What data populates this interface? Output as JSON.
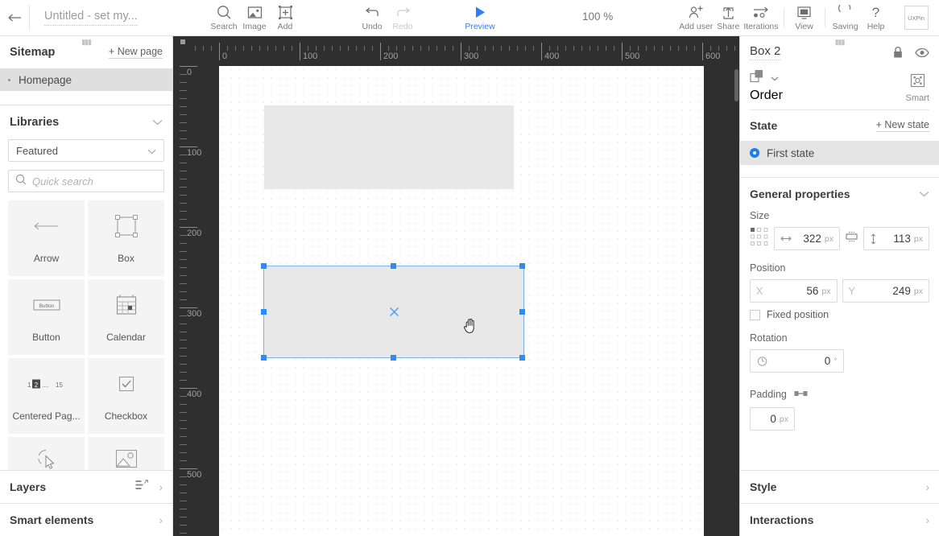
{
  "topbar": {
    "back_icon": "arrow-left-icon",
    "project_title_placeholder": "Untitled - set my...",
    "tools": [
      {
        "label": "Search",
        "icon": "search-icon",
        "state": "normal"
      },
      {
        "label": "Image",
        "icon": "image-icon",
        "state": "normal"
      },
      {
        "label": "Add",
        "icon": "add-element-icon",
        "state": "normal"
      }
    ],
    "history": [
      {
        "label": "Undo",
        "icon": "undo-icon",
        "state": "normal"
      },
      {
        "label": "Redo",
        "icon": "redo-icon",
        "state": "disabled"
      }
    ],
    "preview": {
      "label": "Preview",
      "icon": "play-icon",
      "state": "active"
    },
    "zoom_level": "100 %",
    "right_tools": [
      {
        "label": "Add user",
        "icon": "add-user-icon"
      },
      {
        "label": "Share",
        "icon": "share-icon"
      },
      {
        "label": "Iterations",
        "icon": "iterations-icon"
      },
      {
        "label": "View",
        "icon": "monitor-icon"
      },
      {
        "label": "Saving",
        "icon": "saving-spinner-icon"
      },
      {
        "label": "Help",
        "icon": "question-mark-icon"
      }
    ],
    "logo_text": "UXPin"
  },
  "sidebar": {
    "sitemap": {
      "title": "Sitemap",
      "new_page_label": "New page",
      "pages": [
        {
          "label": "Homepage",
          "selected": true
        }
      ]
    },
    "libraries": {
      "title": "Libraries",
      "library_select_value": "Featured",
      "search_placeholder": "Quick search",
      "components": [
        {
          "label": "Arrow",
          "icon": "arrow-left-thin-icon"
        },
        {
          "label": "Box",
          "icon": "box-handles-icon"
        },
        {
          "label": "Button",
          "icon": "button-icon"
        },
        {
          "label": "Calendar",
          "icon": "calendar-icon"
        },
        {
          "label": "Centered Pag...",
          "icon": "pagination-icon"
        },
        {
          "label": "Checkbox",
          "icon": "checkbox-icon"
        },
        {
          "label": "",
          "icon": "click-cursor-icon"
        },
        {
          "label": "",
          "icon": "image-placeholder-icon"
        }
      ]
    },
    "footer": [
      {
        "label": "Layers",
        "icon": "layers-icon"
      },
      {
        "label": "Smart elements",
        "icon": ""
      }
    ]
  },
  "canvas": {
    "ruler_h_labels": [
      "0",
      "100",
      "200",
      "300",
      "400",
      "500",
      "600"
    ],
    "ruler_v_labels": [
      "0",
      "100",
      "200",
      "300",
      "400",
      "500"
    ],
    "elements": [
      {
        "name": "top-grey-box",
        "selected": false
      },
      {
        "name": "box-2",
        "selected": true
      }
    ],
    "cursor": "grab-hand-cursor"
  },
  "properties": {
    "element_name": "Box 2",
    "lock_icon": "lock-icon",
    "visibility_icon": "eye-icon",
    "order_label": "Order",
    "smart_label": "Smart",
    "state_section": {
      "title": "State",
      "new_state_label": "New state",
      "states": [
        {
          "label": "First state",
          "selected": true
        }
      ]
    },
    "general": {
      "title": "General properties",
      "size_label": "Size",
      "width_value": "322",
      "width_unit": "px",
      "height_value": "113",
      "height_unit": "px",
      "position_label": "Position",
      "x_axis": "X",
      "x_value": "56",
      "x_unit": "px",
      "y_axis": "Y",
      "y_value": "249",
      "y_unit": "px",
      "fixed_position_label": "Fixed position",
      "fixed_position_checked": false,
      "rotation_label": "Rotation",
      "rotation_value": "0",
      "rotation_unit": "°",
      "padding_label": "Padding",
      "padding_value": "0",
      "padding_unit": "px"
    },
    "footer": [
      {
        "label": "Style"
      },
      {
        "label": "Interactions"
      }
    ]
  }
}
